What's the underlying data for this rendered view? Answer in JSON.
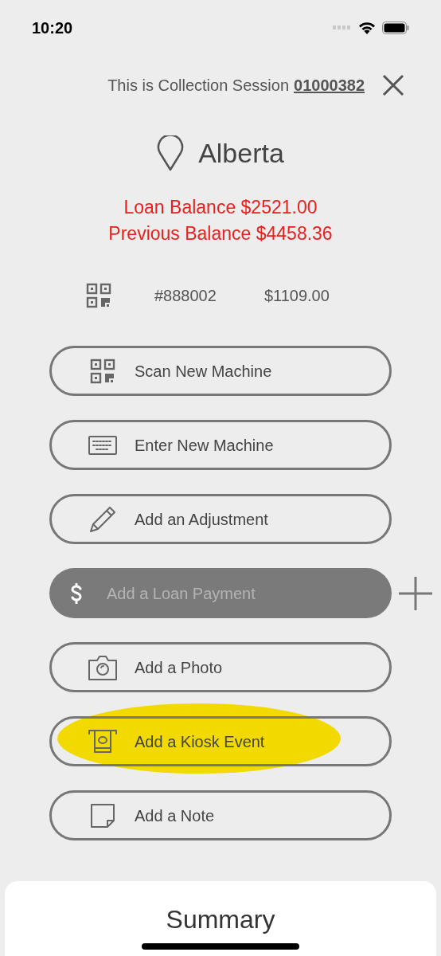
{
  "status_bar": {
    "time": "10:20"
  },
  "header": {
    "prefix": "This is Collection Session",
    "session_number": "01000382"
  },
  "location": {
    "name": "Alberta"
  },
  "balances": [
    {
      "text": "Loan Balance $2521.00"
    },
    {
      "text": "Previous Balance $4458.36"
    }
  ],
  "machine": {
    "number": "#888002",
    "amount": "$1109.00"
  },
  "actions": [
    {
      "kind": "qr",
      "label": "Scan New Machine",
      "disabled": false,
      "highlighted": false,
      "add": false
    },
    {
      "kind": "keyboard",
      "label": "Enter New Machine",
      "disabled": false,
      "highlighted": false,
      "add": false
    },
    {
      "kind": "pencil",
      "label": "Add an Adjustment",
      "disabled": false,
      "highlighted": false,
      "add": false
    },
    {
      "kind": "dollar",
      "label": "Add a Loan Payment",
      "disabled": true,
      "highlighted": false,
      "add": true
    },
    {
      "kind": "camera",
      "label": "Add a Photo",
      "disabled": false,
      "highlighted": false,
      "add": false
    },
    {
      "kind": "kiosk",
      "label": "Add a Kiosk Event",
      "disabled": false,
      "highlighted": true,
      "add": false
    },
    {
      "kind": "note",
      "label": "Add a Note",
      "disabled": false,
      "highlighted": false,
      "add": false
    }
  ],
  "summary": {
    "title": "Summary"
  }
}
